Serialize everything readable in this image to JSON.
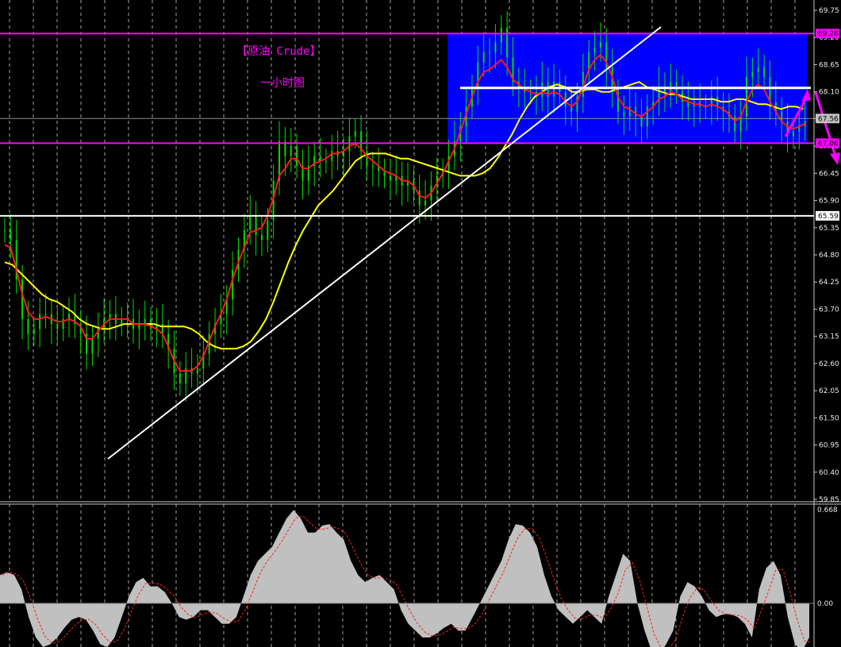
{
  "chart_data": [
    {
      "type": "candlestick",
      "title": "【原油 Crude】",
      "subtitle": "一小时图",
      "ylim": [
        59.85,
        69.75
      ],
      "y_ticks": [
        "69.75",
        "69.20",
        "68.65",
        "68.10",
        "67.56",
        "67.00",
        "66.45",
        "65.90",
        "65.35",
        "64.80",
        "64.25",
        "63.70",
        "63.15",
        "62.60",
        "62.05",
        "61.50",
        "60.95",
        "60.40",
        "59.85"
      ],
      "grid": "vertical dashed",
      "price_tags": [
        {
          "label": "69.28",
          "value": 69.28,
          "color": "#ff00ff"
        },
        {
          "label": "67.56",
          "value": 67.56,
          "color": "#c0c0c0"
        },
        {
          "label": "67.06",
          "value": 67.06,
          "color": "#ff00ff"
        },
        {
          "label": "65.59",
          "value": 65.59,
          "color": "#ffffff"
        }
      ],
      "series": [
        {
          "kind": "ohlc",
          "color": "#00cc00",
          "close": [
            65.3,
            65.1,
            64.3,
            63.5,
            63.2,
            63.3,
            63.6,
            63.6,
            63.4,
            63.3,
            63.5,
            63.6,
            63.4,
            63.2,
            62.8,
            63.1,
            63.3,
            63.5,
            63.6,
            63.4,
            63.5,
            63.5,
            63.3,
            63.4,
            63.5,
            63.3,
            63.4,
            63.2,
            62.9,
            62.4,
            62.2,
            62.5,
            62.4,
            62.5,
            62.8,
            63.2,
            63.4,
            63.6,
            63.9,
            64.5,
            64.9,
            65.3,
            65.6,
            65.2,
            65.1,
            65.5,
            66.3,
            67.1,
            66.8,
            67.0,
            66.6,
            66.3,
            66.6,
            66.8,
            66.7,
            66.7,
            66.9,
            66.8,
            66.9,
            67.2,
            67.3,
            66.9,
            66.6,
            66.6,
            66.5,
            66.4,
            66.3,
            66.4,
            66.2,
            66.3,
            66.1,
            65.8,
            65.9,
            66.2,
            66.4,
            66.5,
            66.8,
            67.1,
            67.4,
            67.8,
            68.2,
            68.7,
            68.9,
            68.9,
            69.1,
            69.4,
            68.8,
            68.3,
            68.2,
            68.1,
            68.1,
            68.0,
            68.3,
            68.0,
            68.3,
            68.1,
            67.8,
            67.7,
            68.0,
            68.5,
            68.9,
            69.0,
            69.1,
            68.6,
            68.1,
            67.7,
            67.6,
            67.8,
            67.6,
            67.4,
            67.8,
            67.9,
            68.2,
            68.1,
            68.3,
            68.1,
            67.9,
            67.8,
            67.9,
            67.8,
            67.8,
            68.0,
            67.8,
            67.7,
            67.6,
            67.3,
            67.6,
            68.4,
            68.5,
            68.6,
            68.4,
            67.9,
            67.7,
            67.5,
            67.2,
            67.3,
            67.4,
            67.5
          ]
        },
        {
          "kind": "ma-fast",
          "color": "#ff1a1a",
          "values": [
            65.0,
            64.95,
            64.5,
            64.0,
            63.65,
            63.5,
            63.5,
            63.55,
            63.5,
            63.45,
            63.45,
            63.5,
            63.45,
            63.35,
            63.1,
            63.1,
            63.25,
            63.4,
            63.5,
            63.5,
            63.5,
            63.5,
            63.4,
            63.4,
            63.4,
            63.35,
            63.3,
            63.2,
            62.95,
            62.65,
            62.45,
            62.45,
            62.45,
            62.55,
            62.75,
            63.05,
            63.35,
            63.6,
            63.9,
            64.3,
            64.65,
            64.95,
            65.25,
            65.3,
            65.35,
            65.6,
            65.95,
            66.4,
            66.55,
            66.75,
            66.75,
            66.55,
            66.55,
            66.65,
            66.7,
            66.75,
            66.85,
            66.85,
            66.9,
            67.0,
            67.05,
            66.95,
            66.8,
            66.7,
            66.6,
            66.5,
            66.45,
            66.4,
            66.3,
            66.3,
            66.2,
            66.0,
            65.95,
            66.05,
            66.25,
            66.45,
            66.7,
            66.95,
            67.3,
            67.65,
            68.0,
            68.3,
            68.5,
            68.55,
            68.65,
            68.75,
            68.6,
            68.35,
            68.25,
            68.15,
            68.1,
            68.05,
            68.1,
            68.05,
            68.1,
            68.05,
            67.9,
            67.8,
            67.9,
            68.2,
            68.55,
            68.75,
            68.85,
            68.7,
            68.4,
            68.0,
            67.8,
            67.75,
            67.65,
            67.6,
            67.7,
            67.8,
            67.95,
            68.0,
            68.1,
            68.05,
            67.95,
            67.9,
            67.85,
            67.85,
            67.8,
            67.85,
            67.8,
            67.75,
            67.65,
            67.5,
            67.6,
            67.9,
            68.15,
            68.25,
            68.15,
            67.9,
            67.7,
            67.5,
            67.4,
            67.35,
            67.4,
            67.45
          ]
        },
        {
          "kind": "ma-slow",
          "color": "#ffff00",
          "values": [
            64.65,
            64.6,
            64.45,
            64.3,
            64.15,
            64.0,
            63.9,
            63.85,
            63.75,
            63.65,
            63.5,
            63.4,
            63.35,
            63.3,
            63.3,
            63.35,
            63.4,
            63.4,
            63.4,
            63.4,
            63.4,
            63.35,
            63.35,
            63.35,
            63.35,
            63.3,
            63.2,
            63.05,
            62.95,
            62.9,
            62.9,
            62.9,
            62.95,
            63.05,
            63.25,
            63.5,
            63.85,
            64.25,
            64.65,
            65.0,
            65.3,
            65.55,
            65.8,
            65.95,
            66.1,
            66.3,
            66.5,
            66.7,
            66.8,
            66.85,
            66.85,
            66.85,
            66.8,
            66.75,
            66.75,
            66.7,
            66.65,
            66.6,
            66.55,
            66.5,
            66.45,
            66.4,
            66.4,
            66.4,
            66.45,
            66.55,
            66.75,
            67.0,
            67.25,
            67.55,
            67.8,
            68.0,
            68.1,
            68.2,
            68.25,
            68.2,
            68.1,
            68.1,
            68.15,
            68.15,
            68.1,
            68.1,
            68.15,
            68.2,
            68.25,
            68.3,
            68.2,
            68.15,
            68.1,
            68.05,
            68.05,
            68.0,
            67.95,
            67.95,
            67.95,
            67.95,
            67.9,
            67.9,
            67.95,
            67.95,
            67.9,
            67.85,
            67.85,
            67.8,
            67.75,
            67.8,
            67.8,
            67.75
          ]
        }
      ]
    },
    {
      "type": "histogram",
      "y_ticks": [
        "0.668",
        "0.00"
      ],
      "ylim": [
        -0.32,
        0.668
      ],
      "values": [
        0.2,
        0.22,
        0.2,
        0.1,
        -0.1,
        -0.25,
        -0.32,
        -0.3,
        -0.25,
        -0.18,
        -0.12,
        -0.1,
        -0.12,
        -0.2,
        -0.3,
        -0.32,
        -0.25,
        -0.1,
        0.05,
        0.15,
        0.18,
        0.12,
        0.12,
        0.08,
        0.0,
        -0.1,
        -0.12,
        -0.1,
        -0.05,
        -0.05,
        -0.1,
        -0.15,
        -0.15,
        -0.1,
        0.05,
        0.2,
        0.3,
        0.35,
        0.4,
        0.5,
        0.6,
        0.66,
        0.6,
        0.5,
        0.5,
        0.55,
        0.56,
        0.5,
        0.45,
        0.3,
        0.2,
        0.15,
        0.18,
        0.2,
        0.15,
        0.1,
        -0.05,
        -0.15,
        -0.2,
        -0.25,
        -0.25,
        -0.22,
        -0.18,
        -0.15,
        -0.2,
        -0.2,
        -0.1,
        0.0,
        0.1,
        0.2,
        0.3,
        0.45,
        0.56,
        0.55,
        0.5,
        0.4,
        0.2,
        0.05,
        -0.05,
        -0.1,
        -0.15,
        -0.1,
        -0.05,
        -0.1,
        -0.15,
        0.05,
        0.2,
        0.35,
        0.3,
        0.0,
        -0.2,
        -0.35,
        -0.38,
        -0.3,
        -0.2,
        0.05,
        0.15,
        0.12,
        0.05,
        -0.05,
        -0.1,
        -0.08,
        -0.08,
        -0.1,
        -0.15,
        -0.25,
        0.1,
        0.25,
        0.3,
        0.2,
        -0.1,
        -0.3,
        -0.35,
        -0.25
      ]
    }
  ]
}
